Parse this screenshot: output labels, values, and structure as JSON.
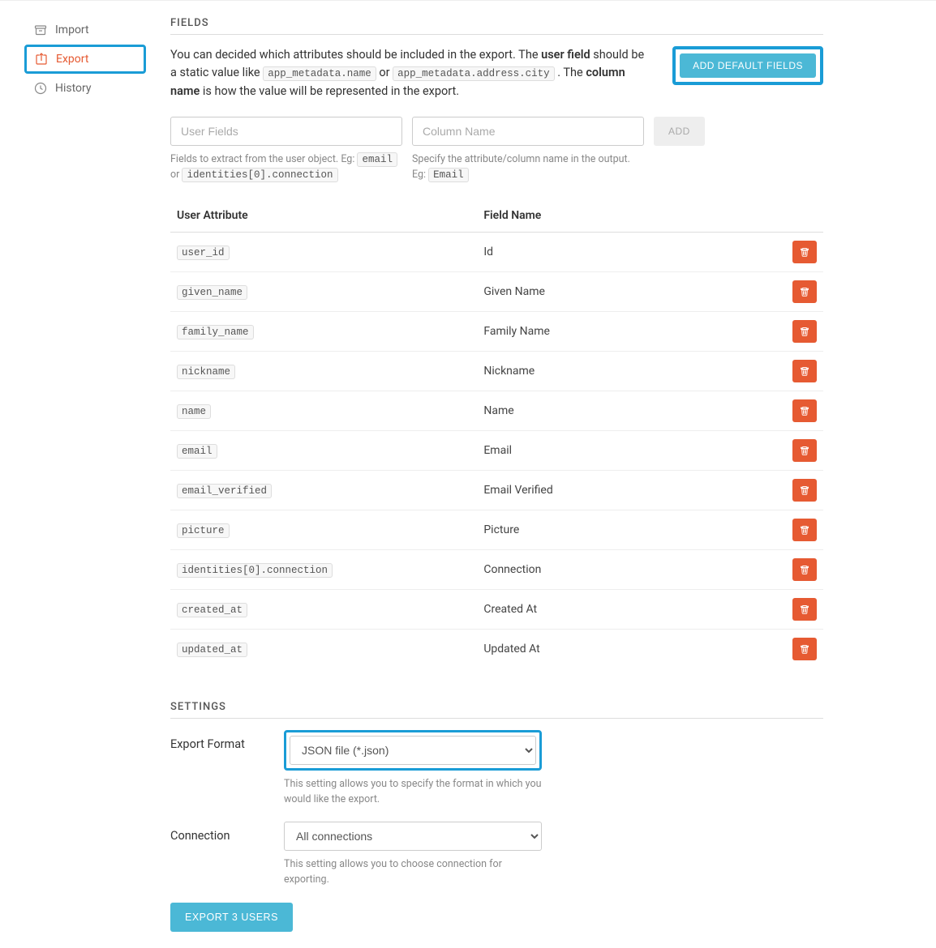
{
  "sidebar": {
    "items": [
      {
        "label": "Import"
      },
      {
        "label": "Export"
      },
      {
        "label": "History"
      }
    ]
  },
  "fields": {
    "heading": "FIELDS",
    "desc_part1": "You can decided which attributes should be included in the export. The ",
    "desc_bold1": "user field",
    "desc_part2": " should be a static value like ",
    "desc_code1": "app_metadata.name",
    "desc_or": " or ",
    "desc_code2": "app_metadata.address.city",
    "desc_part3": " . The ",
    "desc_bold2": "column name",
    "desc_part4": " is how the value will be represented in the export.",
    "add_default_label": "ADD DEFAULT FIELDS",
    "user_fields_placeholder": "User Fields",
    "column_name_placeholder": "Column Name",
    "add_button_label": "ADD",
    "help_userfields_part1": "Fields to extract from the user object. Eg: ",
    "help_userfields_code1": "email",
    "help_userfields_or": " or ",
    "help_userfields_code2": "identities[0].connection",
    "help_colname_part1": "Specify the attribute/column name in the output. Eg: ",
    "help_colname_code1": "Email"
  },
  "table": {
    "headers": {
      "attr": "User Attribute",
      "name": "Field Name"
    },
    "rows": [
      {
        "attr": "user_id",
        "name": "Id"
      },
      {
        "attr": "given_name",
        "name": "Given Name"
      },
      {
        "attr": "family_name",
        "name": "Family Name"
      },
      {
        "attr": "nickname",
        "name": "Nickname"
      },
      {
        "attr": "name",
        "name": "Name"
      },
      {
        "attr": "email",
        "name": "Email"
      },
      {
        "attr": "email_verified",
        "name": "Email Verified"
      },
      {
        "attr": "picture",
        "name": "Picture"
      },
      {
        "attr": "identities[0].connection",
        "name": "Connection"
      },
      {
        "attr": "created_at",
        "name": "Created At"
      },
      {
        "attr": "updated_at",
        "name": "Updated At"
      }
    ]
  },
  "settings": {
    "heading": "SETTINGS",
    "format_label": "Export Format",
    "format_value": "JSON file (*.json)",
    "format_help": "This setting allows you to specify the format in which you would like the export.",
    "connection_label": "Connection",
    "connection_value": "All connections",
    "connection_help": "This setting allows you to choose connection for exporting.",
    "export_button_label": "EXPORT 3 USERS"
  }
}
